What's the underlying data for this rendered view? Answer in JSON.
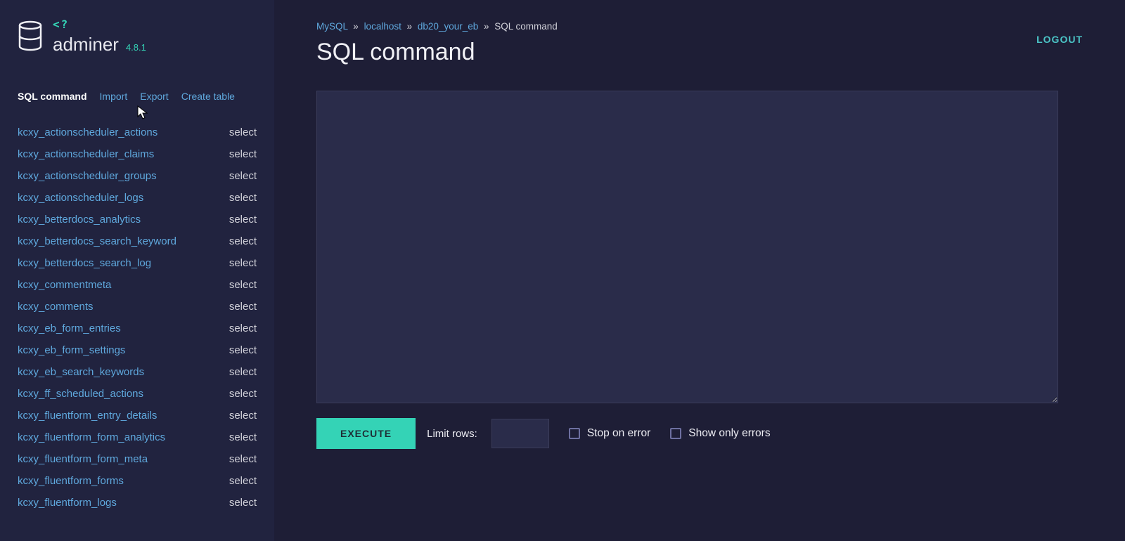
{
  "logo": {
    "brand": "adminer",
    "version": "4.8.1",
    "code_hint": "<?"
  },
  "sidebar_nav": [
    {
      "label": "SQL command",
      "active": true
    },
    {
      "label": "Import",
      "active": false
    },
    {
      "label": "Export",
      "active": false
    },
    {
      "label": "Create table",
      "active": false
    }
  ],
  "select_label": "select",
  "tables": [
    "kcxy_actionscheduler_actions",
    "kcxy_actionscheduler_claims",
    "kcxy_actionscheduler_groups",
    "kcxy_actionscheduler_logs",
    "kcxy_betterdocs_analytics",
    "kcxy_betterdocs_search_keyword",
    "kcxy_betterdocs_search_log",
    "kcxy_commentmeta",
    "kcxy_comments",
    "kcxy_eb_form_entries",
    "kcxy_eb_form_settings",
    "kcxy_eb_search_keywords",
    "kcxy_ff_scheduled_actions",
    "kcxy_fluentform_entry_details",
    "kcxy_fluentform_form_analytics",
    "kcxy_fluentform_form_meta",
    "kcxy_fluentform_forms",
    "kcxy_fluentform_logs"
  ],
  "breadcrumb": {
    "driver": "MySQL",
    "server": "localhost",
    "db": "db20_your_eb",
    "page": "SQL command",
    "sep": "»"
  },
  "page_title": "SQL command",
  "logout": "LOGOUT",
  "controls": {
    "execute": "EXECUTE",
    "limit_label": "Limit rows:",
    "limit_value": "",
    "stop_on_error": "Stop on error",
    "show_only_errors": "Show only errors"
  }
}
